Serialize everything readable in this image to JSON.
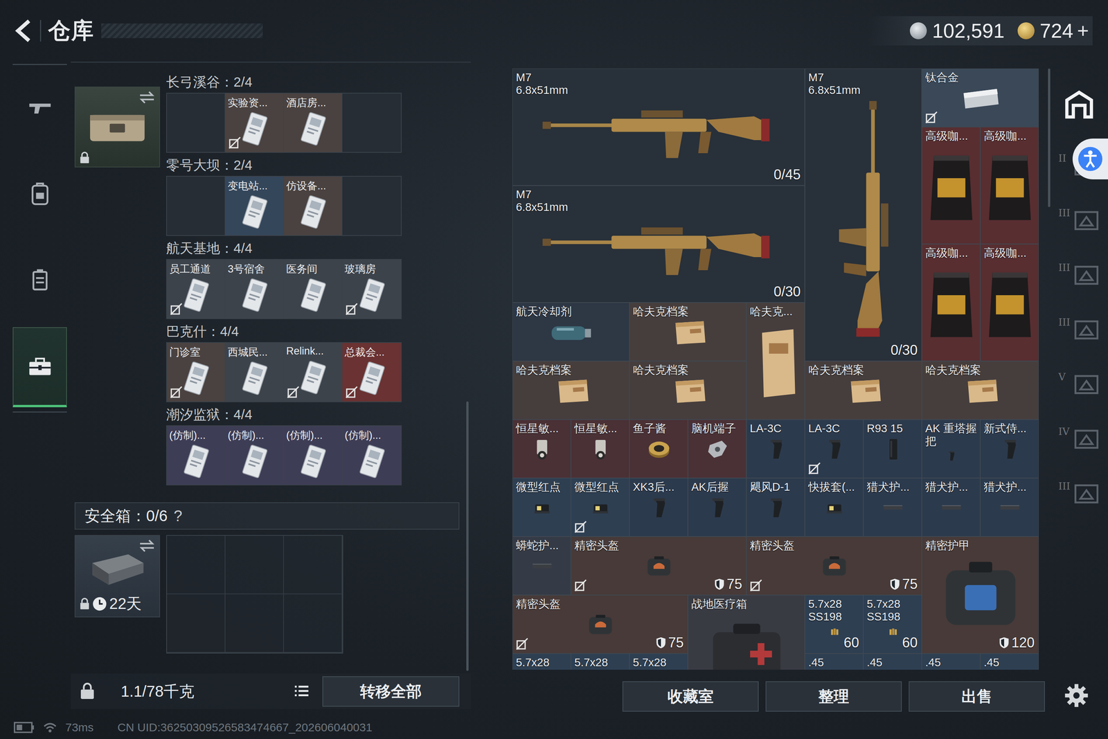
{
  "header": {
    "title": "仓库",
    "currency": [
      {
        "value": "102,591",
        "kind": "silver"
      },
      {
        "value": "724",
        "kind": "gold"
      }
    ],
    "topup": "+"
  },
  "nav_rail": [
    {
      "selected": false
    },
    {
      "selected": false
    },
    {
      "selected": false
    },
    {
      "selected": true
    }
  ],
  "keycard_holder": {
    "locked": true
  },
  "key_maps": [
    {
      "title": "长弓溪谷：2/4",
      "slots": [
        {
          "empty": true
        },
        {
          "label": "实验资...",
          "bound": true,
          "color": "#4a4240"
        },
        {
          "label": "酒店房...",
          "bound": false,
          "color": "#4a4240"
        },
        {
          "empty": true
        }
      ]
    },
    {
      "title": "零号大坝：2/4",
      "slots": [
        {
          "empty": true
        },
        {
          "label": "变电站...",
          "bound": false,
          "color": "#34465a"
        },
        {
          "label": "仿设备...",
          "bound": false,
          "color": "#4a4240"
        },
        {
          "empty": true
        }
      ]
    },
    {
      "title": "航天基地：4/4",
      "slots": [
        {
          "label": "员工通道",
          "bound": true,
          "color": "#3d434b"
        },
        {
          "label": "3号宿舍",
          "bound": false,
          "color": "#3d434b"
        },
        {
          "label": "医务间",
          "bound": false,
          "color": "#3d434b"
        },
        {
          "label": "玻璃房",
          "bound": true,
          "color": "#3d434b"
        }
      ]
    },
    {
      "title": "巴克什：4/4",
      "slots": [
        {
          "label": "门诊室",
          "bound": true,
          "color": "#4a4240"
        },
        {
          "label": "西城民...",
          "bound": false,
          "color": "#3d434b"
        },
        {
          "label": "Relink...",
          "bound": true,
          "color": "#3d434b"
        },
        {
          "label": "总裁会...",
          "bound": true,
          "color": "#6a3232"
        }
      ]
    },
    {
      "title": "潮汐监狱：4/4",
      "slots": [
        {
          "label": "(仿制)...",
          "bound": false,
          "color": "#3e3d56"
        },
        {
          "label": "(仿制)...",
          "bound": false,
          "color": "#3e3d56"
        },
        {
          "label": "(仿制)...",
          "bound": false,
          "color": "#3e3d56"
        },
        {
          "label": "(仿制)...",
          "bound": false,
          "color": "#3e3d56"
        }
      ]
    }
  ],
  "safe_box": {
    "title": "安全箱：0/6",
    "help": "?",
    "timer": "22天",
    "locked": true,
    "slots": 6
  },
  "footer_left": {
    "weight": "1.1/78千克",
    "transfer_button": "转移全部"
  },
  "stash": {
    "items": [
      {
        "name": "M7",
        "caliber": "6.8x51mm",
        "count": "0/45",
        "kind": "rifle",
        "bound": false,
        "color": "#283039"
      },
      {
        "name": "M7",
        "caliber": "6.8x51mm",
        "count": "0/30",
        "kind": "rifle-v",
        "bound": false,
        "color": "#283039"
      },
      {
        "name": "钛合金",
        "kind": "plate",
        "bound": true,
        "color": "#3a4858"
      },
      {
        "name": "高级咖...",
        "kind": "coffee",
        "bound": false,
        "color": "#582e31"
      },
      {
        "name": "高级咖...",
        "kind": "coffee",
        "bound": false,
        "color": "#582e31"
      },
      {
        "name": "M7",
        "caliber": "6.8x51mm",
        "count": "0/30",
        "kind": "rifle",
        "bound": false,
        "color": "#283039"
      },
      {
        "name": "高级咖...",
        "kind": "coffee",
        "bound": false,
        "color": "#582e31"
      },
      {
        "name": "高级咖...",
        "kind": "coffee",
        "bound": false,
        "color": "#582e31"
      },
      {
        "name": "航天冷却剂",
        "kind": "canister",
        "bound": false,
        "color": "#2e3744"
      },
      {
        "name": "哈夫克档案",
        "kind": "file",
        "bound": false,
        "color": "#463e3d"
      },
      {
        "name": "哈夫克...",
        "kind": "file-v",
        "bound": false,
        "color": "#463e3d"
      },
      {
        "name": "哈夫克档案",
        "kind": "file",
        "bound": false,
        "color": "#463e3d"
      },
      {
        "name": "哈夫克档案",
        "kind": "file",
        "bound": false,
        "color": "#463e3d"
      },
      {
        "name": "哈夫克档案",
        "kind": "file",
        "bound": false,
        "color": "#463e3d"
      },
      {
        "name": "哈夫克档案",
        "kind": "file",
        "bound": false,
        "color": "#463e3d"
      },
      {
        "name": "恒星敏...",
        "kind": "sensor",
        "bound": false,
        "color": "#4a3136"
      },
      {
        "name": "恒星敏...",
        "kind": "sensor",
        "bound": false,
        "color": "#4a3136"
      },
      {
        "name": "鱼子酱",
        "kind": "tin",
        "bound": false,
        "color": "#4a3136"
      },
      {
        "name": "脑机端子",
        "kind": "device",
        "bound": false,
        "color": "#4a3136"
      },
      {
        "name": "LA-3C",
        "kind": "grip",
        "bound": false,
        "color": "#2c3a4d"
      },
      {
        "name": "LA-3C",
        "kind": "grip",
        "bound": true,
        "color": "#2c3a4d"
      },
      {
        "name": "R93 15",
        "kind": "mag",
        "bound": false,
        "color": "#2c3a4d"
      },
      {
        "name": "AK 重塔握把",
        "kind": "grip",
        "bound": false,
        "color": "#2c3a4d"
      },
      {
        "name": "新式侍...",
        "kind": "grip",
        "bound": false,
        "color": "#2c3a4d"
      },
      {
        "name": "微型红点",
        "kind": "sight",
        "bound": false,
        "color": "#2e3f52"
      },
      {
        "name": "微型红点",
        "kind": "sight",
        "bound": true,
        "color": "#2e3f52"
      },
      {
        "name": "XK3后...",
        "kind": "grip",
        "bound": false,
        "color": "#2c3a4d"
      },
      {
        "name": "AK后握",
        "kind": "grip",
        "bound": false,
        "color": "#2c3a4d"
      },
      {
        "name": "飓风D-1",
        "kind": "grip",
        "bound": false,
        "color": "#2c3a4d"
      },
      {
        "name": "快拔套(...",
        "kind": "sight",
        "bound": false,
        "color": "#2c3a4d"
      },
      {
        "name": "猎犬护...",
        "kind": "rail",
        "bound": false,
        "color": "#2c3a4d"
      },
      {
        "name": "猎犬护...",
        "kind": "rail",
        "bound": false,
        "color": "#2c3a4d"
      },
      {
        "name": "猎犬护...",
        "kind": "rail",
        "bound": false,
        "color": "#2c3a4d"
      },
      {
        "name": "蟒蛇护...",
        "kind": "rail",
        "bound": false,
        "color": "#353b46"
      },
      {
        "name": "精密头盔",
        "armor": "75",
        "kind": "helmet",
        "bound": true,
        "color": "#473a38"
      },
      {
        "name": "精密头盔",
        "armor": "75",
        "kind": "helmet",
        "bound": true,
        "color": "#473a38"
      },
      {
        "name": "精密护甲",
        "armor": "120",
        "kind": "armor",
        "bound": false,
        "color": "#473a38"
      },
      {
        "name": "精密头盔",
        "armor": "75",
        "kind": "helmet",
        "bound": true,
        "color": "#473a38"
      },
      {
        "name": "战地医疗箱",
        "kind": "medkit",
        "bound": false,
        "color": "#393b43"
      },
      {
        "name": "5.7x28 SS198",
        "count": "60",
        "kind": "ammo",
        "bound": false,
        "color": "#2e3f52"
      },
      {
        "name": "5.7x28 SS198",
        "count": "60",
        "kind": "ammo",
        "bound": false,
        "color": "#2e3f52"
      },
      {
        "name": "5.7x28",
        "kind": "ammo",
        "bound": false,
        "color": "#2e3f52"
      },
      {
        "name": "5.7x28",
        "kind": "ammo",
        "bound": false,
        "color": "#2e3f52"
      },
      {
        "name": "5.7x28",
        "kind": "ammo",
        "bound": false,
        "color": "#2e3f52"
      },
      {
        "name": ".45",
        "kind": "ammo",
        "bound": false,
        "color": "#2e3f52"
      },
      {
        "name": ".45",
        "kind": "ammo",
        "bound": false,
        "color": "#2e3f52"
      },
      {
        "name": ".45",
        "kind": "ammo",
        "bound": false,
        "color": "#2e3f52"
      },
      {
        "name": ".45",
        "kind": "ammo",
        "bound": false,
        "color": "#2e3f52"
      }
    ]
  },
  "side_tabs": {
    "home_selected": true,
    "tabs": [
      {
        "label": "II",
        "selected": false
      },
      {
        "label": "III",
        "selected": false
      },
      {
        "label": "III",
        "selected": false
      },
      {
        "label": "III",
        "selected": false
      },
      {
        "label": "V",
        "selected": false
      },
      {
        "label": "IV",
        "selected": false
      },
      {
        "label": "III",
        "selected": false
      }
    ]
  },
  "actions": [
    "收藏室",
    "整理",
    "出售"
  ],
  "status_bar": {
    "ping": "73ms",
    "uid": "CN UID:36250309526583474667_202606040031"
  }
}
